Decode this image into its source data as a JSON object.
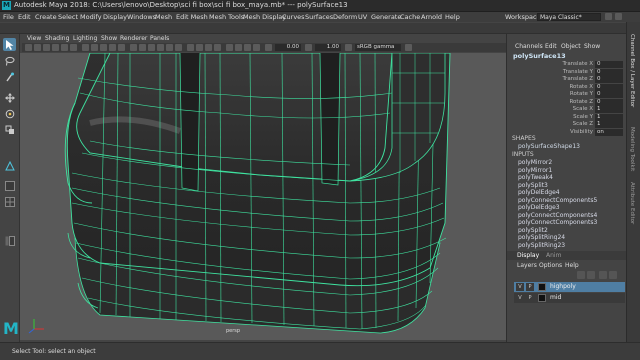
{
  "window": {
    "title": "Autodesk Maya 2018: C:\\Users\\lenovo\\Desktop\\sci fi box\\sci fi box_maya.mb* --- polySurface13"
  },
  "menu": {
    "items": [
      "File",
      "Edit",
      "Create",
      "Select",
      "Modify",
      "Display",
      "Windows",
      "Mesh",
      "Edit Mesh",
      "Mesh Tools",
      "Mesh Display",
      "Curves",
      "Surfaces",
      "Deform",
      "UV",
      "Generate",
      "Cache",
      "Arnold",
      "Help"
    ]
  },
  "workspace": {
    "label": "Workspace :",
    "value": "Maya Classic*"
  },
  "viewport": {
    "menu": [
      "View",
      "Shading",
      "Lighting",
      "Show",
      "Renderer",
      "Panels"
    ],
    "exposure": "0.00",
    "gamma": "1.00",
    "colorspace": "sRGB gamma",
    "camera_label": "persp"
  },
  "channel_box": {
    "tabs": [
      "Channels",
      "Edit",
      "Object",
      "Show"
    ],
    "object": "polySurface13",
    "attributes": [
      {
        "label": "Translate X",
        "value": "0"
      },
      {
        "label": "Translate Y",
        "value": "0"
      },
      {
        "label": "Translate Z",
        "value": "0"
      },
      {
        "label": "Rotate X",
        "value": "0"
      },
      {
        "label": "Rotate Y",
        "value": "0"
      },
      {
        "label": "Rotate Z",
        "value": "0"
      },
      {
        "label": "Scale X",
        "value": "1"
      },
      {
        "label": "Scale Y",
        "value": "1"
      },
      {
        "label": "Scale Z",
        "value": "1"
      },
      {
        "label": "Visibility",
        "value": "on"
      }
    ],
    "shapes_header": "SHAPES",
    "shape": "polySurfaceShape13",
    "inputs_header": "INPUTS",
    "inputs": [
      "polyMirror2",
      "polyMirror1",
      "polyTweak4",
      "polySplit3",
      "polyDelEdge4",
      "polyConnectComponents5",
      "polyDelEdge3",
      "polyConnectComponents4",
      "polyConnectComponents3",
      "polySplit2",
      "polySplitRing24",
      "polySplitRing23"
    ]
  },
  "layers": {
    "tabs": [
      "Display",
      "Anim"
    ],
    "menu": [
      "Layers",
      "Options",
      "Help"
    ],
    "rows": [
      {
        "v": "V",
        "p": "P",
        "name": "highpoly",
        "selected": true
      },
      {
        "v": "V",
        "p": "P",
        "name": "mid",
        "selected": false
      }
    ]
  },
  "side_tabs": [
    "Channel Box / Layer Editor",
    "Modeling Toolkit",
    "Attribute Editor"
  ],
  "status": {
    "text": "Select Tool: select an object"
  },
  "brand": {
    "logo_letter": "M"
  },
  "colors": {
    "wire": "#3fe3a0",
    "selected_blue": "#5285a6",
    "layer_selected": "#4f7ea3"
  }
}
